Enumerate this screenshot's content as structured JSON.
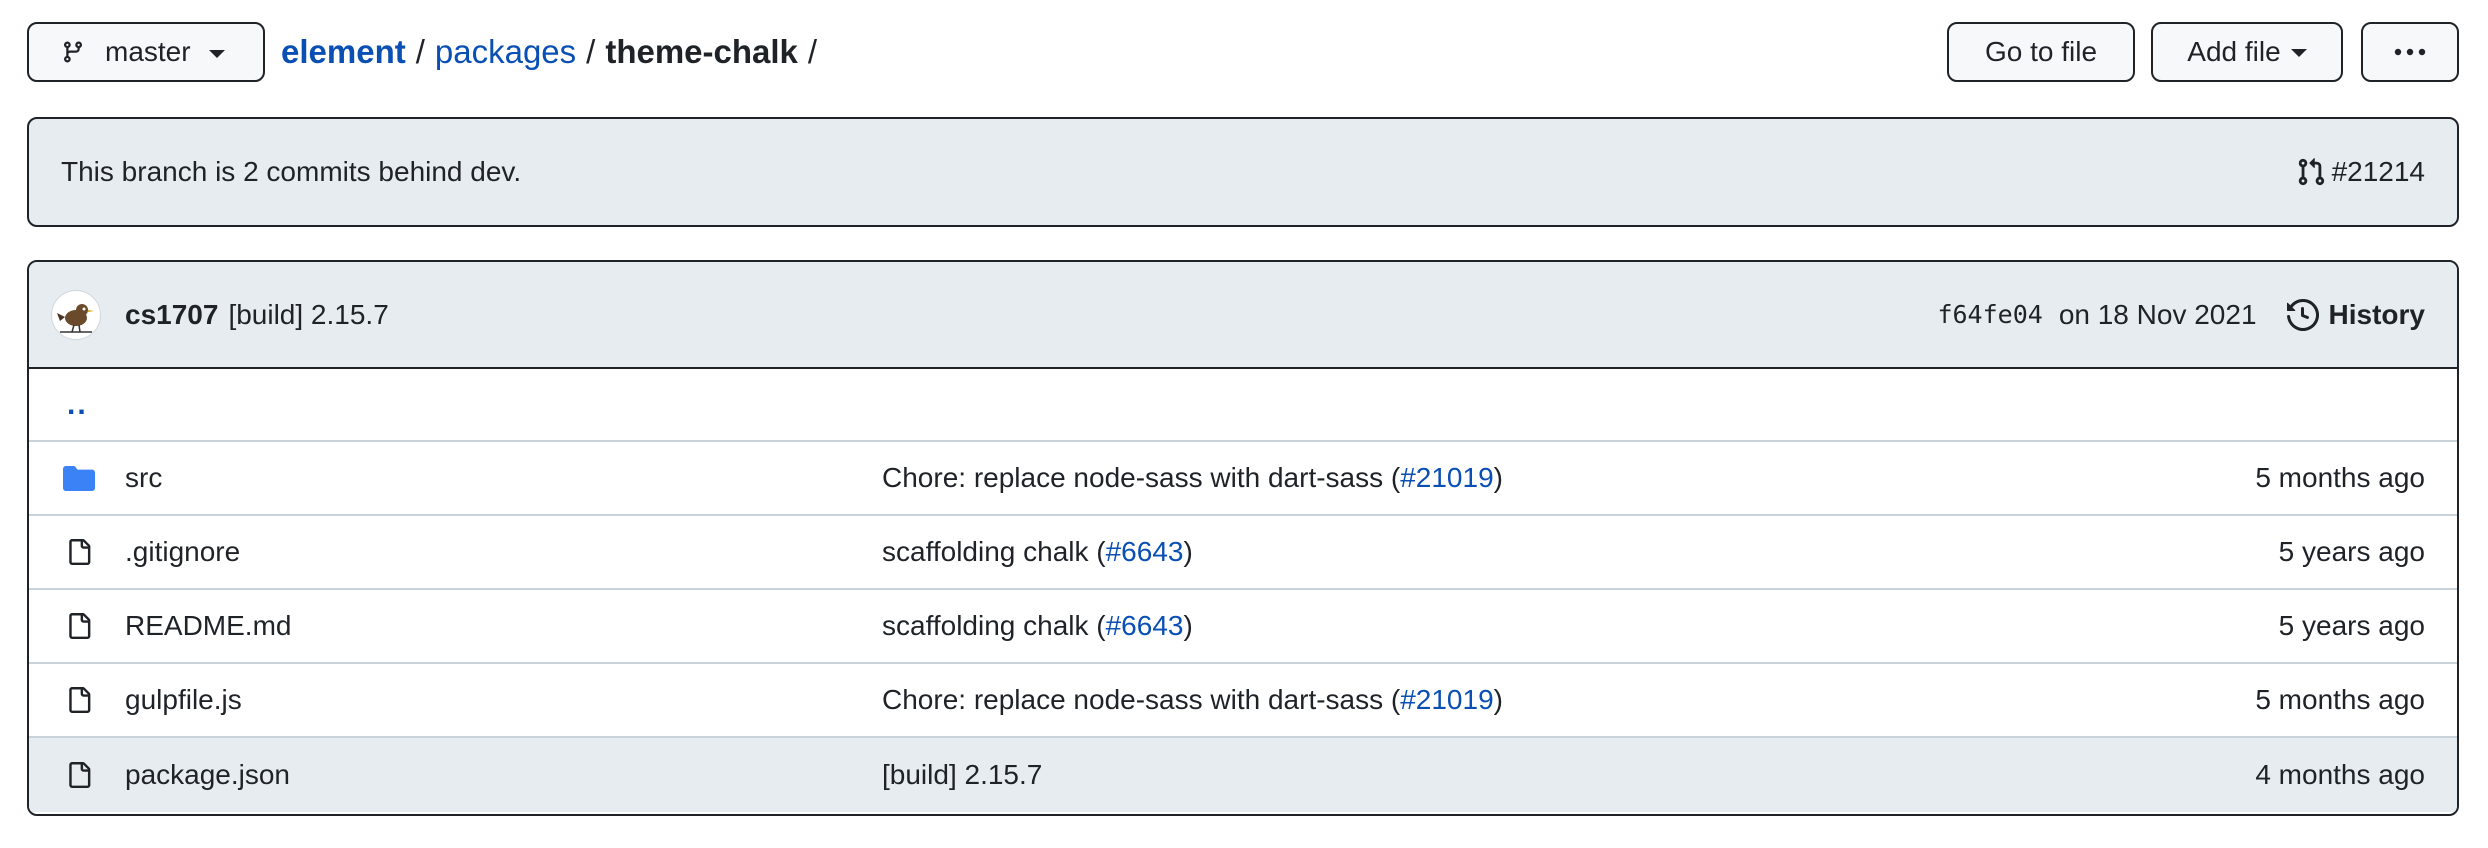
{
  "branch": {
    "name": "master"
  },
  "breadcrumb": {
    "repo": "element",
    "dir": "packages",
    "current": "theme-chalk",
    "sep": "/",
    "trailing_sep": "/"
  },
  "toolbar": {
    "go_to_file": "Go to file",
    "add_file": "Add file",
    "more_icon": "kebab-horizontal-icon"
  },
  "banner": {
    "text": "This branch is 2 commits behind dev.",
    "pr_label": "#21214",
    "pr_icon": "git-pull-request-icon"
  },
  "latest_commit": {
    "author": "cs1707",
    "message": "[build] 2.15.7",
    "sha": "f64fe04",
    "date": "on 18 Nov 2021",
    "history_label": "History"
  },
  "parent_dir": {
    "label": ".."
  },
  "files": [
    {
      "name": "src",
      "type": "dir",
      "msg_pre": "Chore: replace node-sass with dart-sass (",
      "msg_link": "#21019",
      "msg_post": ")",
      "age": "5 months ago"
    },
    {
      "name": ".gitignore",
      "type": "file",
      "msg_pre": "scaffolding chalk (",
      "msg_link": "#6643",
      "msg_post": ")",
      "age": "5 years ago"
    },
    {
      "name": "README.md",
      "type": "file",
      "msg_pre": "scaffolding chalk (",
      "msg_link": "#6643",
      "msg_post": ")",
      "age": "5 years ago"
    },
    {
      "name": "gulpfile.js",
      "type": "file",
      "msg_pre": "Chore: replace node-sass with dart-sass (",
      "msg_link": "#21019",
      "msg_post": ")",
      "age": "5 months ago"
    },
    {
      "name": "package.json",
      "type": "file",
      "msg_pre": "[build] 2.15.7",
      "msg_link": "",
      "msg_post": "",
      "age": "4 months ago"
    }
  ],
  "colors": {
    "link": "#0a4fb4",
    "folder": "#3b82f6",
    "header_bg": "#e7ecf1",
    "border": "#1f2328"
  }
}
